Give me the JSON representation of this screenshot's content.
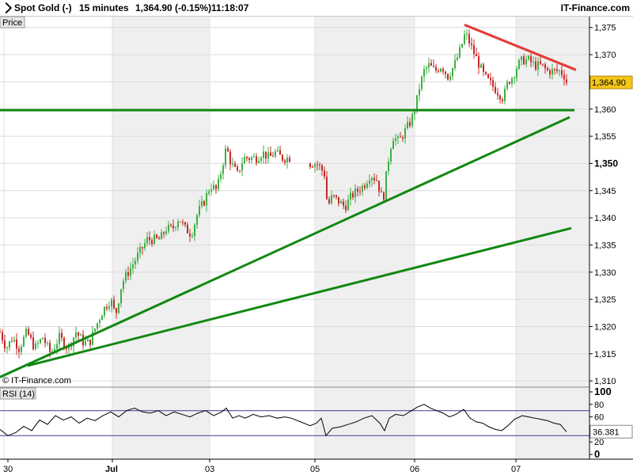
{
  "header": {
    "instrument": "Spot Gold (-)",
    "timeframe": "15 minutes",
    "quote": "1,364.90 (-0.15%)",
    "time": "11:18:07",
    "brand": "IT-Finance.com"
  },
  "chart_data": [
    {
      "type": "candlestick",
      "panel_label": "Price",
      "watermark": "© IT-Finance.com",
      "last_price": 1364.9,
      "last_price_label": "1,364.90",
      "ylim": [
        1309,
        1377
      ],
      "yticks": [
        1310,
        1315,
        1320,
        1325,
        1330,
        1335,
        1340,
        1345,
        1350,
        1355,
        1360,
        1365,
        1370,
        1375
      ],
      "ytick_labels": [
        "1,310",
        "1,315",
        "1,320",
        "1,325",
        "1,330",
        "1,335",
        "1,340",
        "1,345",
        "1,350",
        "1,355",
        "1,360",
        "1,365",
        "1,370",
        "1,375"
      ],
      "x_tick_labels": [
        "30",
        "Jul",
        "03",
        "05",
        "06",
        "07"
      ],
      "up_color": "#3cb043",
      "down_color": "#c62828",
      "grid": true,
      "price_path": [
        {
          "x": 0,
          "y": 1319
        },
        {
          "x": 8,
          "y": 1316
        },
        {
          "x": 16,
          "y": 1318
        },
        {
          "x": 24,
          "y": 1316
        },
        {
          "x": 34,
          "y": 1319
        },
        {
          "x": 44,
          "y": 1316
        },
        {
          "x": 54,
          "y": 1318
        },
        {
          "x": 64,
          "y": 1315
        },
        {
          "x": 75,
          "y": 1318
        },
        {
          "x": 86,
          "y": 1316
        },
        {
          "x": 96,
          "y": 1319
        },
        {
          "x": 106,
          "y": 1317
        },
        {
          "x": 113,
          "y": 1317
        },
        {
          "x": 121,
          "y": 1320
        },
        {
          "x": 130,
          "y": 1323
        },
        {
          "x": 140,
          "y": 1325
        },
        {
          "x": 146,
          "y": 1322
        },
        {
          "x": 154,
          "y": 1328
        },
        {
          "x": 162,
          "y": 1330
        },
        {
          "x": 170,
          "y": 1332
        },
        {
          "x": 178,
          "y": 1334
        },
        {
          "x": 186,
          "y": 1336
        },
        {
          "x": 194,
          "y": 1336
        },
        {
          "x": 202,
          "y": 1336
        },
        {
          "x": 210,
          "y": 1338
        },
        {
          "x": 218,
          "y": 1338
        },
        {
          "x": 226,
          "y": 1340
        },
        {
          "x": 234,
          "y": 1338
        },
        {
          "x": 242,
          "y": 1337
        },
        {
          "x": 250,
          "y": 1341
        },
        {
          "x": 258,
          "y": 1343
        },
        {
          "x": 266,
          "y": 1346
        },
        {
          "x": 274,
          "y": 1345
        },
        {
          "x": 280,
          "y": 1349
        },
        {
          "x": 286,
          "y": 1353
        },
        {
          "x": 292,
          "y": 1350
        },
        {
          "x": 300,
          "y": 1348
        },
        {
          "x": 308,
          "y": 1351
        },
        {
          "x": 316,
          "y": 1351
        },
        {
          "x": 324,
          "y": 1351
        },
        {
          "x": 332,
          "y": 1352
        },
        {
          "x": 340,
          "y": 1351
        },
        {
          "x": 348,
          "y": 1352
        },
        {
          "x": 356,
          "y": 1351
        },
        {
          "x": 362,
          "y": 1351
        },
        {
          "x": 368,
          "y": 1351
        }
      ],
      "price_path_2": [
        {
          "x": 392,
          "y": 1350
        },
        {
          "x": 400,
          "y": 1350
        },
        {
          "x": 406,
          "y": 1349
        },
        {
          "x": 410,
          "y": 1348
        },
        {
          "x": 414,
          "y": 1342
        },
        {
          "x": 420,
          "y": 1344
        },
        {
          "x": 428,
          "y": 1343
        },
        {
          "x": 436,
          "y": 1342
        },
        {
          "x": 444,
          "y": 1344
        },
        {
          "x": 452,
          "y": 1345
        },
        {
          "x": 460,
          "y": 1346
        },
        {
          "x": 468,
          "y": 1348
        },
        {
          "x": 476,
          "y": 1347
        },
        {
          "x": 484,
          "y": 1343
        },
        {
          "x": 490,
          "y": 1350
        },
        {
          "x": 496,
          "y": 1355
        },
        {
          "x": 504,
          "y": 1354
        },
        {
          "x": 512,
          "y": 1356
        },
        {
          "x": 520,
          "y": 1358
        },
        {
          "x": 526,
          "y": 1361
        },
        {
          "x": 530,
          "y": 1364
        },
        {
          "x": 536,
          "y": 1367
        },
        {
          "x": 542,
          "y": 1368
        },
        {
          "x": 550,
          "y": 1367
        },
        {
          "x": 558,
          "y": 1368
        },
        {
          "x": 566,
          "y": 1366
        },
        {
          "x": 574,
          "y": 1368
        },
        {
          "x": 582,
          "y": 1371
        },
        {
          "x": 588,
          "y": 1374
        },
        {
          "x": 594,
          "y": 1372
        },
        {
          "x": 600,
          "y": 1370
        },
        {
          "x": 606,
          "y": 1368
        },
        {
          "x": 612,
          "y": 1366
        },
        {
          "x": 618,
          "y": 1365
        },
        {
          "x": 624,
          "y": 1364
        },
        {
          "x": 630,
          "y": 1363
        },
        {
          "x": 636,
          "y": 1362
        },
        {
          "x": 642,
          "y": 1365
        },
        {
          "x": 648,
          "y": 1366
        },
        {
          "x": 654,
          "y": 1368
        },
        {
          "x": 660,
          "y": 1369
        },
        {
          "x": 668,
          "y": 1369
        },
        {
          "x": 676,
          "y": 1368
        },
        {
          "x": 684,
          "y": 1368
        },
        {
          "x": 692,
          "y": 1367
        },
        {
          "x": 700,
          "y": 1367
        },
        {
          "x": 708,
          "y": 1367
        },
        {
          "x": 714,
          "y": 1366
        },
        {
          "x": 716,
          "y": 1365
        }
      ],
      "trendlines": [
        {
          "color": "#e53935",
          "x1": 587,
          "y1": 1375.5,
          "x2": 728,
          "y2": 1367.2
        },
        {
          "color": "#118811",
          "x1": 0,
          "y1": 1359.8,
          "x2": 726,
          "y2": 1359.8
        },
        {
          "color": "#118811",
          "x1": 0,
          "y1": 1310.7,
          "x2": 720,
          "y2": 1358.5
        },
        {
          "color": "#118811",
          "x1": 35,
          "y1": 1312.8,
          "x2": 722,
          "y2": 1338.1
        }
      ]
    },
    {
      "type": "line",
      "panel_label": "RSI (14)",
      "ylim": [
        0,
        100
      ],
      "yticks": [
        0,
        20,
        40,
        60,
        80,
        100
      ],
      "ytick_labels": [
        "0",
        "20",
        "40",
        "60",
        "80",
        "100"
      ],
      "levels": [
        30,
        70
      ],
      "last_value": 36.381,
      "last_value_label": "36.381",
      "line_color": "#000000",
      "series": [
        {
          "x": 0,
          "y": 40
        },
        {
          "x": 10,
          "y": 30
        },
        {
          "x": 20,
          "y": 35
        },
        {
          "x": 30,
          "y": 45
        },
        {
          "x": 40,
          "y": 38
        },
        {
          "x": 50,
          "y": 55
        },
        {
          "x": 60,
          "y": 48
        },
        {
          "x": 70,
          "y": 62
        },
        {
          "x": 80,
          "y": 55
        },
        {
          "x": 90,
          "y": 60
        },
        {
          "x": 100,
          "y": 50
        },
        {
          "x": 110,
          "y": 58
        },
        {
          "x": 120,
          "y": 54
        },
        {
          "x": 130,
          "y": 62
        },
        {
          "x": 140,
          "y": 68
        },
        {
          "x": 150,
          "y": 60
        },
        {
          "x": 160,
          "y": 70
        },
        {
          "x": 170,
          "y": 74
        },
        {
          "x": 180,
          "y": 68
        },
        {
          "x": 190,
          "y": 66
        },
        {
          "x": 200,
          "y": 70
        },
        {
          "x": 210,
          "y": 62
        },
        {
          "x": 220,
          "y": 68
        },
        {
          "x": 230,
          "y": 64
        },
        {
          "x": 240,
          "y": 60
        },
        {
          "x": 250,
          "y": 66
        },
        {
          "x": 260,
          "y": 70
        },
        {
          "x": 270,
          "y": 62
        },
        {
          "x": 280,
          "y": 68
        },
        {
          "x": 286,
          "y": 74
        },
        {
          "x": 294,
          "y": 58
        },
        {
          "x": 302,
          "y": 62
        },
        {
          "x": 310,
          "y": 58
        },
        {
          "x": 320,
          "y": 64
        },
        {
          "x": 330,
          "y": 60
        },
        {
          "x": 340,
          "y": 62
        },
        {
          "x": 350,
          "y": 58
        },
        {
          "x": 360,
          "y": 60
        },
        {
          "x": 368,
          "y": 58
        },
        {
          "x": 392,
          "y": 46
        },
        {
          "x": 400,
          "y": 50
        },
        {
          "x": 406,
          "y": 58
        },
        {
          "x": 412,
          "y": 30
        },
        {
          "x": 420,
          "y": 42
        },
        {
          "x": 430,
          "y": 44
        },
        {
          "x": 440,
          "y": 48
        },
        {
          "x": 450,
          "y": 52
        },
        {
          "x": 460,
          "y": 58
        },
        {
          "x": 470,
          "y": 62
        },
        {
          "x": 480,
          "y": 50
        },
        {
          "x": 486,
          "y": 38
        },
        {
          "x": 492,
          "y": 58
        },
        {
          "x": 500,
          "y": 64
        },
        {
          "x": 510,
          "y": 62
        },
        {
          "x": 520,
          "y": 70
        },
        {
          "x": 528,
          "y": 76
        },
        {
          "x": 536,
          "y": 80
        },
        {
          "x": 544,
          "y": 74
        },
        {
          "x": 552,
          "y": 70
        },
        {
          "x": 560,
          "y": 66
        },
        {
          "x": 568,
          "y": 60
        },
        {
          "x": 576,
          "y": 64
        },
        {
          "x": 586,
          "y": 72
        },
        {
          "x": 594,
          "y": 58
        },
        {
          "x": 602,
          "y": 52
        },
        {
          "x": 610,
          "y": 50
        },
        {
          "x": 618,
          "y": 44
        },
        {
          "x": 626,
          "y": 40
        },
        {
          "x": 634,
          "y": 38
        },
        {
          "x": 642,
          "y": 46
        },
        {
          "x": 650,
          "y": 56
        },
        {
          "x": 660,
          "y": 62
        },
        {
          "x": 668,
          "y": 60
        },
        {
          "x": 676,
          "y": 58
        },
        {
          "x": 684,
          "y": 56
        },
        {
          "x": 692,
          "y": 54
        },
        {
          "x": 700,
          "y": 50
        },
        {
          "x": 708,
          "y": 48
        },
        {
          "x": 716,
          "y": 36
        }
      ]
    }
  ]
}
